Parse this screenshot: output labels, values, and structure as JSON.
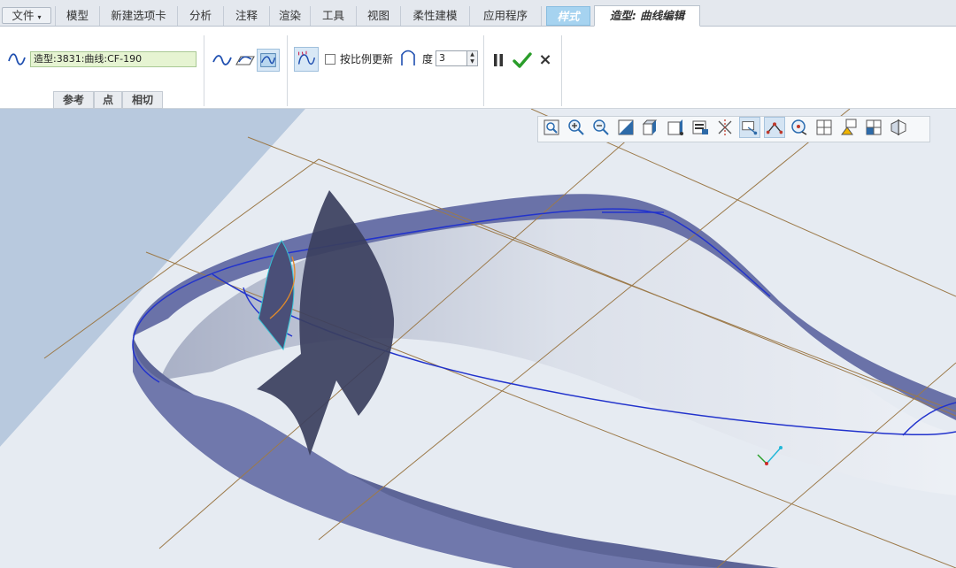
{
  "menu": {
    "file_label": "文件",
    "tabs": [
      "模型",
      "新建选项卡",
      "分析",
      "注释",
      "渲染",
      "工具",
      "视图",
      "柔性建模",
      "应用程序"
    ],
    "style_tab": "样式",
    "active_tab": "造型: 曲线编辑"
  },
  "ribbon": {
    "curve_name": "造型:3831:曲线:CF-190",
    "subtabs": [
      "参考",
      "点",
      "相切"
    ],
    "proportional_update_label": "按比例更新",
    "proportional_update_checked": false,
    "degree_label": "度",
    "degree_value": "3",
    "cancel_glyph": "×"
  },
  "graphics_toolbar": {
    "tools": [
      "refit-icon",
      "zoom-in-icon",
      "zoom-out-icon",
      "repaint-icon",
      "display-style-icon",
      "saved-views-icon",
      "view-manager-icon",
      "datum-display-icon",
      "curvature-icon",
      "connection-icon",
      "spin-center-icon",
      "annotation-display-icon",
      "section-icon",
      "plane-display-icon",
      "cut-icon"
    ]
  },
  "colors": {
    "accent": "#1f6fd1",
    "check_green": "#2a9d2a",
    "surface_blue": "#6a72a8",
    "curve_blue": "#2233cc",
    "datum_brown": "#9c7a4a"
  }
}
